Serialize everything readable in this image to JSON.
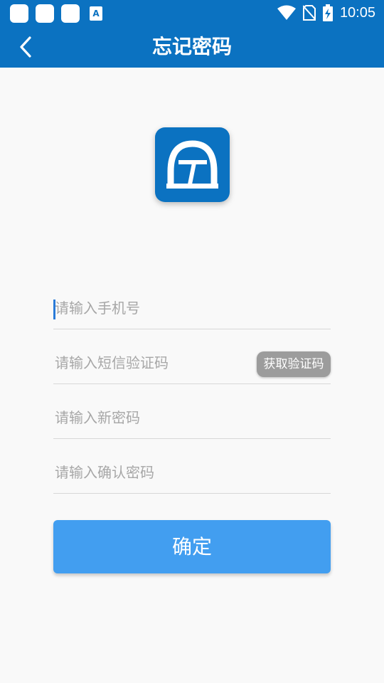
{
  "status_bar": {
    "time": "10:05",
    "notif_icons": [
      "app-notification-icon",
      "app-notification-icon",
      "app-notification-icon",
      "accessibility-icon"
    ],
    "accessibility_glyph": "A",
    "right_icons": [
      "wifi-icon",
      "no-sim-icon",
      "battery-charging-icon"
    ]
  },
  "header": {
    "title": "忘记密码",
    "back_icon": "chevron-left-icon",
    "color": "#0b72c1"
  },
  "form": {
    "phone_placeholder": "请输入手机号",
    "sms_code_placeholder": "请输入短信验证码",
    "get_code_label": "获取验证码",
    "new_password_placeholder": "请输入新密码",
    "confirm_password_placeholder": "请输入确认密码",
    "submit_label": "确定",
    "submit_color": "#429ef0"
  }
}
